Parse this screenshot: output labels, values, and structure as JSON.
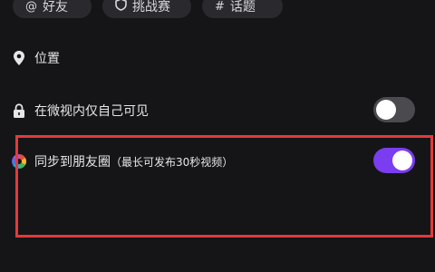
{
  "tabs": {
    "friends": {
      "icon": "at-icon",
      "label": "好友"
    },
    "challenge": {
      "icon": "shield-icon",
      "label": "挑战赛"
    },
    "topic": {
      "icon": "hash-icon",
      "label": "话题"
    }
  },
  "settings": {
    "location": {
      "icon": "location-pin-icon",
      "label": "位置"
    },
    "private": {
      "icon": "lock-icon",
      "label": "在微视内仅自己可见",
      "toggle_on": false
    },
    "sync_moments": {
      "icon": "wechat-moments-icon",
      "label": "同步到朋友圈",
      "hint": "（最长可发布30秒视频）",
      "toggle_on": true
    }
  },
  "colors": {
    "background": "#151518",
    "chip_background": "#2a2a2e",
    "toggle_on": "#7a3df0",
    "toggle_off": "#4a4a4f",
    "highlight": "#e23a3a"
  }
}
